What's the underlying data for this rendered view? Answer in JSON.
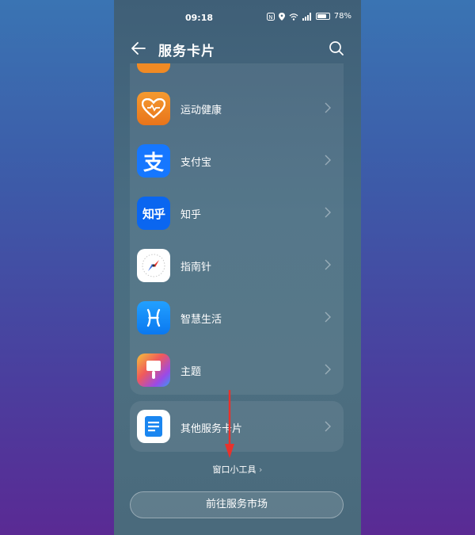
{
  "status_bar": {
    "time": "09:18",
    "battery": "78%",
    "battery_level": 0.78,
    "icons": [
      "nfc-icon",
      "location-icon",
      "wifi-icon",
      "signal-icon",
      "battery-icon"
    ]
  },
  "header": {
    "title": "服务卡片",
    "back_icon": "back-arrow-icon",
    "search_icon": "search-icon"
  },
  "apps": [
    {
      "label": "运动健康",
      "icon": "health-heart-icon",
      "color": "#f08a24"
    },
    {
      "label": "支付宝",
      "icon": "alipay-icon",
      "glyph": "支",
      "color": "#1677ff"
    },
    {
      "label": "知乎",
      "icon": "zhihu-icon",
      "glyph": "知乎",
      "color": "#0a66f0"
    },
    {
      "label": "指南针",
      "icon": "compass-icon",
      "color": "#ffffff"
    },
    {
      "label": "智慧生活",
      "icon": "smart-life-icon",
      "color": "#1a8cff"
    },
    {
      "label": "主题",
      "icon": "theme-brush-icon",
      "color": "#e8504a"
    }
  ],
  "other_cards": {
    "label": "其他服务卡片",
    "icon": "document-icon",
    "color": "#1a86f0"
  },
  "widget_link": "窗口小工具",
  "market_button": "前往服务市场",
  "annotation_color": "#e8322c"
}
